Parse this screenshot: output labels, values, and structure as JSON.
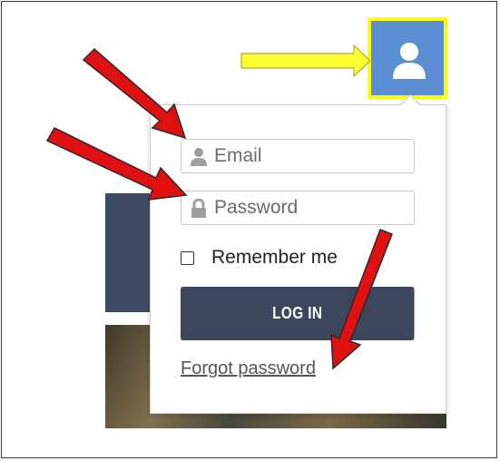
{
  "login": {
    "email_placeholder": "Email",
    "password_placeholder": "Password",
    "remember_label": "Remember me",
    "remember_checked": false,
    "login_label": "LOG IN",
    "forgot_label": "Forgot password"
  },
  "icons": {
    "avatar": "user-icon",
    "email": "user-icon",
    "password": "lock-icon"
  },
  "colors": {
    "avatar_bg": "#5b8ed0",
    "highlight": "#ffff00",
    "button": "#3c475d",
    "annotation_arrow_red": "#e01010",
    "annotation_arrow_yellow": "#ffff33"
  }
}
